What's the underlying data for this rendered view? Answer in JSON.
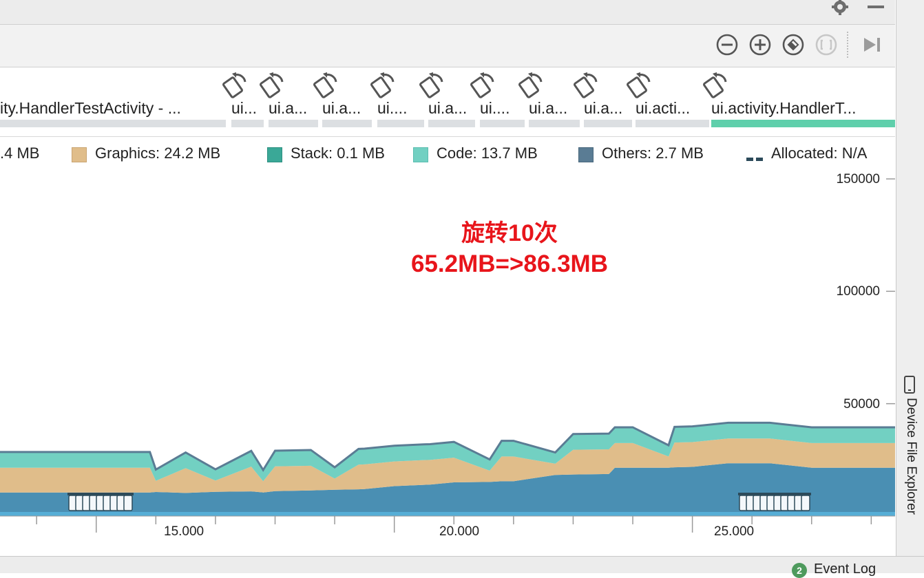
{
  "toolbar": {
    "icons": [
      "settings-icon",
      "minimize-icon",
      "zoom-out-icon",
      "zoom-in-icon",
      "reset-zoom-icon",
      "fit-icon",
      "jump-to-live-icon"
    ]
  },
  "activities": [
    {
      "label": "ity.HandlerTestActivity - ...",
      "active": false
    },
    {
      "label": "ui...",
      "active": false
    },
    {
      "label": "ui.a...",
      "active": false
    },
    {
      "label": "ui.a...",
      "active": false
    },
    {
      "label": "ui....",
      "active": false
    },
    {
      "label": "ui.a...",
      "active": false
    },
    {
      "label": "ui....",
      "active": false
    },
    {
      "label": "ui.a...",
      "active": false
    },
    {
      "label": "ui.a...",
      "active": false
    },
    {
      "label": "ui.acti...",
      "active": false
    },
    {
      "label": "ui.activity.HandlerT...",
      "active": true
    }
  ],
  "legend": [
    {
      "name": ".4 MB",
      "color": "#ffffff"
    },
    {
      "name": "Graphics: 24.2 MB",
      "color": "#e0bd8a"
    },
    {
      "name": "Stack: 0.1 MB",
      "color": "#3aa897"
    },
    {
      "name": "Code: 13.7 MB",
      "color": "#72d0c2"
    },
    {
      "name": "Others: 2.7 MB",
      "color": "#5a7c94"
    },
    {
      "name": "Allocated: N/A",
      "color": "#2c4a5a"
    }
  ],
  "annotation": {
    "line1": "旋转10次",
    "line2": "65.2MB=>86.3MB",
    "color": "#e8151b"
  },
  "chart_data": {
    "type": "area",
    "title": "",
    "xlabel": "",
    "ylabel": "",
    "yticks": [
      "150000",
      "100000",
      "50000"
    ],
    "xticks": [
      "15.000",
      "20.000",
      "25.000"
    ],
    "ylim": [
      0,
      150000
    ],
    "xlim": [
      12.0,
      28.4
    ],
    "x": [
      12.0,
      13.0,
      14.0,
      15.0,
      15.9,
      16.0,
      16.5,
      17.0,
      17.6,
      17.8,
      18.0,
      18.6,
      19.0,
      19.4,
      19.5,
      20.0,
      20.5,
      20.6,
      21.0,
      21.6,
      21.8,
      22.0,
      22.7,
      23.0,
      23.6,
      23.7,
      24.0,
      24.6,
      24.7,
      25.0,
      25.6,
      25.8,
      26.3,
      27.0,
      28.4
    ],
    "series": [
      {
        "name": "Others",
        "color": "#5a7c94",
        "values": [
          1500,
          1500,
          1500,
          1500,
          1500,
          1500,
          1500,
          1500,
          1500,
          1500,
          1500,
          1500,
          1500,
          1500,
          1500,
          1500,
          1500,
          1500,
          1500,
          1500,
          1500,
          1500,
          1500,
          1500,
          1500,
          1500,
          1500,
          1500,
          1500,
          1500,
          1500,
          1500,
          1500,
          1500,
          1500
        ]
      },
      {
        "name": "Native",
        "color": "#4a8fb3",
        "values": [
          9000,
          9000,
          9000,
          9000,
          9000,
          9200,
          8800,
          9300,
          9500,
          9000,
          9600,
          9900,
          10200,
          10400,
          10500,
          11800,
          12400,
          12500,
          13500,
          13700,
          14000,
          14000,
          16800,
          17000,
          17200,
          20000,
          20000,
          20000,
          20200,
          20400,
          22000,
          22000,
          22000,
          20000,
          20000
        ]
      },
      {
        "name": "Graphics",
        "color": "#e0bd8a",
        "values": [
          11000,
          11000,
          11000,
          11000,
          11000,
          5000,
          11000,
          5000,
          11000,
          5000,
          11000,
          11000,
          5000,
          11000,
          11000,
          11000,
          11000,
          11000,
          11000,
          5000,
          11000,
          11000,
          5000,
          11000,
          11000,
          11000,
          11000,
          5000,
          11000,
          11000,
          11000,
          11000,
          11000,
          11000,
          11000
        ]
      },
      {
        "name": "Code",
        "color": "#72d0c2",
        "values": [
          7000,
          7000,
          7000,
          7000,
          7000,
          5000,
          7000,
          5000,
          7000,
          5000,
          7000,
          7000,
          5000,
          7000,
          7000,
          7000,
          7000,
          7000,
          7000,
          5000,
          7000,
          7000,
          5000,
          7000,
          7000,
          7000,
          7000,
          5000,
          7000,
          7000,
          7000,
          7000,
          7000,
          7000,
          7000
        ]
      }
    ],
    "grid": false,
    "legend_position": "top"
  },
  "sidebar": {
    "device_file_explorer": "Device File Explorer"
  },
  "statusbar": {
    "event_log_badge": "2",
    "event_log": "Event Log"
  }
}
